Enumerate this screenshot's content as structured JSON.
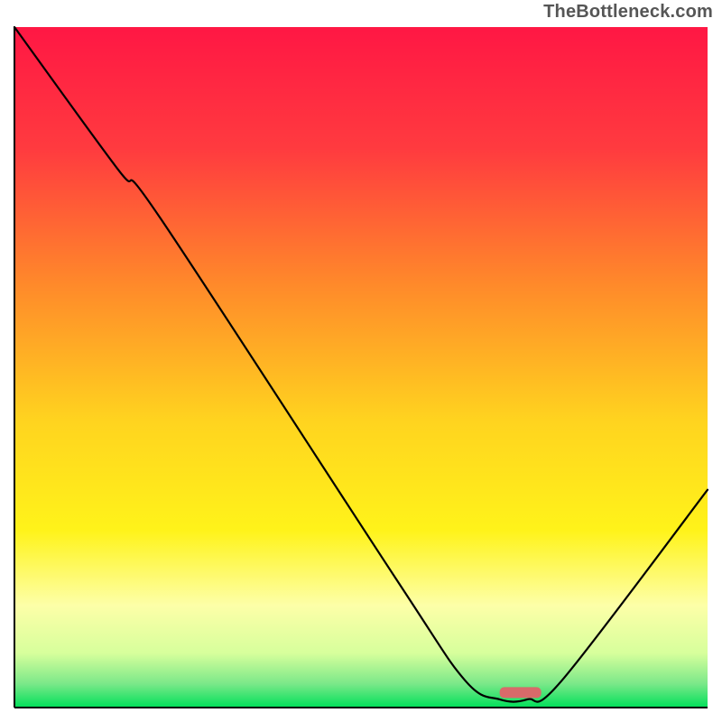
{
  "attribution": "TheBottleneck.com",
  "chart_data": {
    "type": "line",
    "title": "",
    "xlabel": "",
    "ylabel": "",
    "xlim": [
      0,
      100
    ],
    "ylim": [
      0,
      100
    ],
    "gradient_stops": [
      {
        "offset": 0.0,
        "color": "#ff1744"
      },
      {
        "offset": 0.18,
        "color": "#ff3b3f"
      },
      {
        "offset": 0.38,
        "color": "#ff8a2a"
      },
      {
        "offset": 0.58,
        "color": "#ffd41f"
      },
      {
        "offset": 0.74,
        "color": "#fff31a"
      },
      {
        "offset": 0.85,
        "color": "#fdffa8"
      },
      {
        "offset": 0.92,
        "color": "#d7ff9c"
      },
      {
        "offset": 0.965,
        "color": "#7be889"
      },
      {
        "offset": 1.0,
        "color": "#00e05a"
      }
    ],
    "series": [
      {
        "name": "bottleneck-curve",
        "points": [
          {
            "x": 0.0,
            "y": 100.0
          },
          {
            "x": 15.0,
            "y": 79.0
          },
          {
            "x": 21.0,
            "y": 72.0
          },
          {
            "x": 55.0,
            "y": 19.0
          },
          {
            "x": 65.0,
            "y": 4.0
          },
          {
            "x": 70.0,
            "y": 1.2
          },
          {
            "x": 74.0,
            "y": 1.2
          },
          {
            "x": 79.0,
            "y": 4.0
          },
          {
            "x": 100.0,
            "y": 32.0
          }
        ]
      }
    ],
    "marker": {
      "name": "optimal-range",
      "x_start": 70.0,
      "x_end": 76.0,
      "y": 2.2,
      "color": "#d86a6a"
    },
    "axes": {
      "color": "#000000",
      "width": 2
    }
  }
}
